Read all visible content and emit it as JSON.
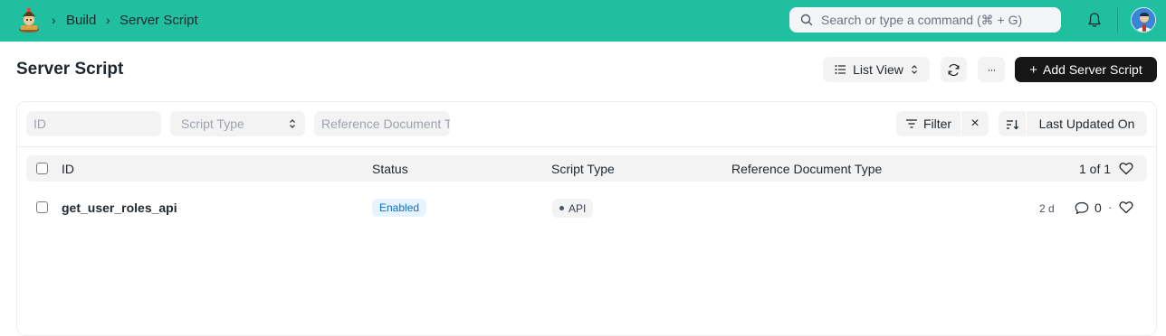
{
  "navbar": {
    "breadcrumbs": [
      "Build",
      "Server Script"
    ],
    "search_placeholder": "Search or type a command (⌘ + G)"
  },
  "page": {
    "title": "Server Script",
    "list_view_label": "List View",
    "more_label": "···",
    "add_button_label": "Add Server Script",
    "add_button_icon": "plus-icon"
  },
  "filters": {
    "id_placeholder": "ID",
    "script_type_placeholder": "Script Type",
    "reference_doc_placeholder": "Reference Document Type",
    "filter_label": "Filter",
    "clear_label": "×",
    "sort_label": "Last Updated On"
  },
  "table": {
    "columns": [
      "ID",
      "Status",
      "Script Type",
      "Reference Document Type"
    ],
    "count_label": "1 of 1",
    "rows": [
      {
        "id": "get_user_roles_api",
        "status": "Enabled",
        "script_type": "API",
        "reference_document_type": "",
        "modified": "2 d",
        "comments": "0",
        "separator": "·"
      }
    ]
  },
  "colors": {
    "navbar": "#1fbfa0",
    "primary_button": "#171717",
    "enabled_pill_bg": "#e6f4ff",
    "enabled_pill_text": "#0d6fc5"
  }
}
